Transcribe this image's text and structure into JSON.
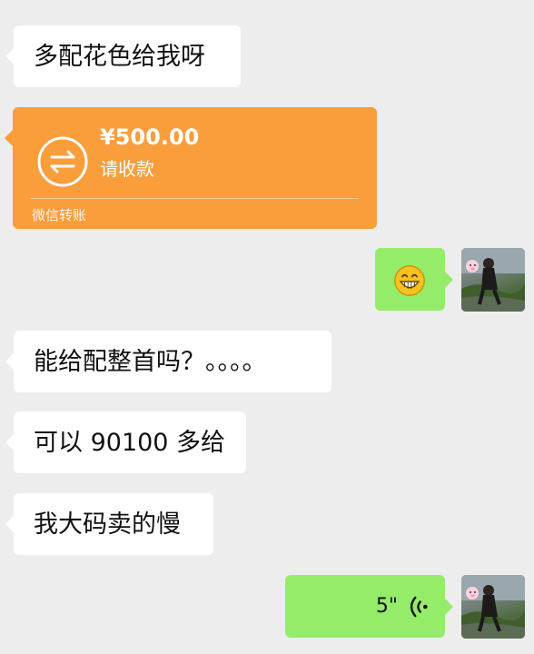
{
  "messages": {
    "m1": "多配花色给我呀",
    "m2": "能给配整首吗？。。。。",
    "m3": "可以 90100 多给",
    "m4": "我大码卖的慢"
  },
  "transfer": {
    "amount": "¥500.00",
    "status": "请收款",
    "footer": "微信转账"
  },
  "voice": {
    "duration": "5\""
  },
  "colors": {
    "background": "#ededed",
    "incoming_bubble": "#ffffff",
    "outgoing_bubble": "#95ec69",
    "transfer_card": "#fa9d3b"
  },
  "icons": {
    "transfer": "transfer-arrows-icon",
    "emoji": "grinning-face-emoji",
    "voice": "voice-wave-icon"
  }
}
